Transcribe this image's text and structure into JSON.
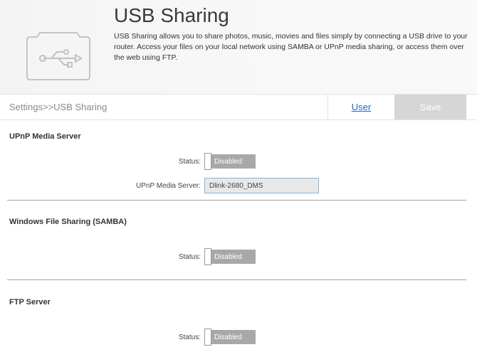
{
  "header": {
    "title": "USB Sharing",
    "description": "USB Sharing allows you to share photos, music, movies and files simply by connecting a USB drive to your router. Access your files on your local network using SAMBA or UPnP media sharing, or access them over the web using FTP.",
    "icon": "usb-drive-icon"
  },
  "toolbar": {
    "breadcrumb": "Settings>>USB Sharing",
    "user_label": "User",
    "save_label": "Save"
  },
  "upnp": {
    "title": "UPnP Media Server",
    "status_label": "Status:",
    "status_value": "Disabled",
    "server_label": "UPnP Media Server:",
    "server_value": "Dlink-2680_DMS"
  },
  "samba": {
    "title": "Windows File Sharing (SAMBA)",
    "status_label": "Status:",
    "status_value": "Disabled"
  },
  "ftp": {
    "title": "FTP Server",
    "status_label": "Status:",
    "status_value": "Disabled"
  },
  "colors": {
    "toggle_off": "#a8a8a8",
    "link": "#2a6aa8",
    "save_disabled": "#d6d6d6"
  }
}
